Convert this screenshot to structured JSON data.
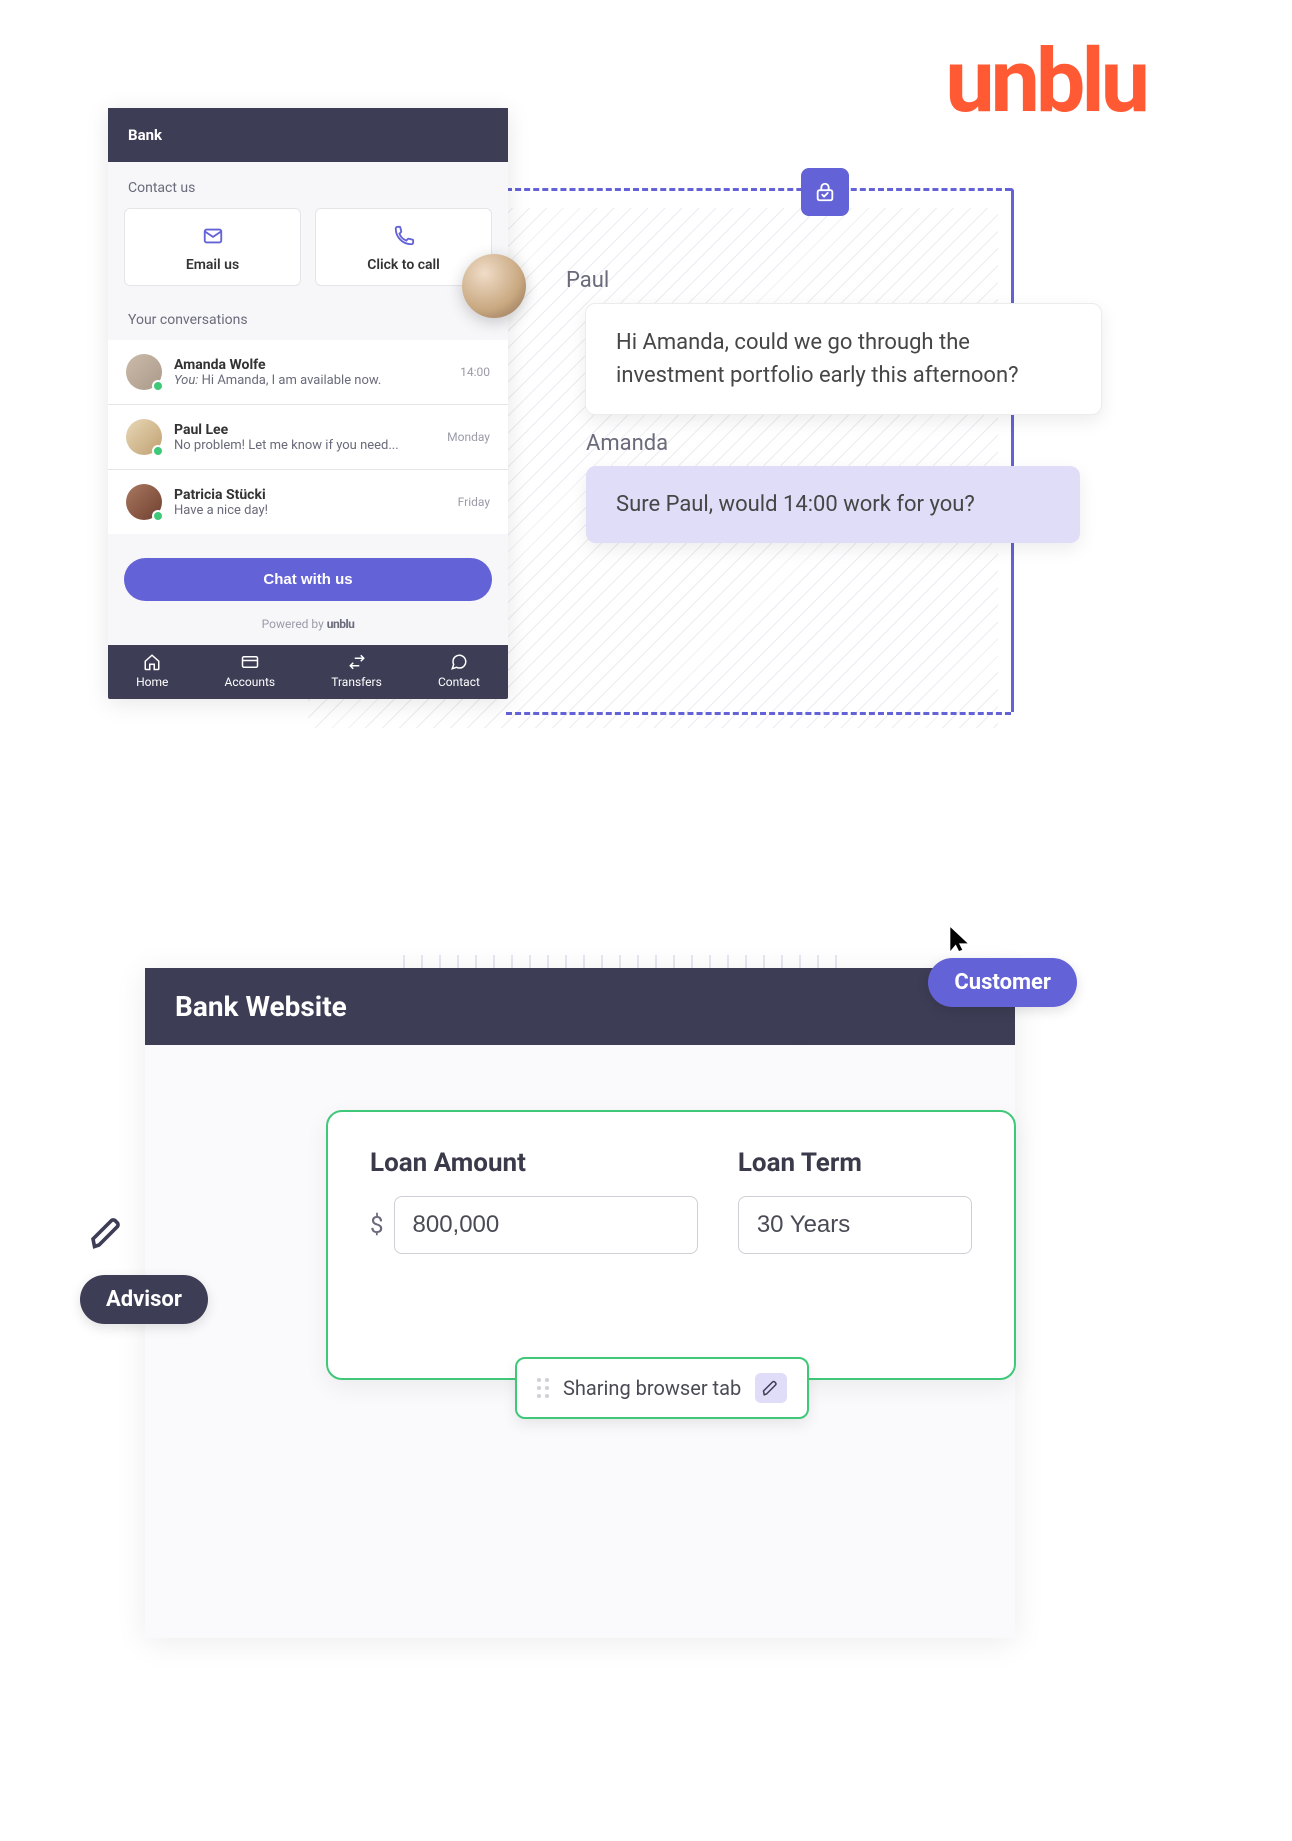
{
  "brand": {
    "logo_text": "unblu"
  },
  "panel_top": {
    "phone": {
      "header_title": "Bank",
      "contact_section_title": "Contact us",
      "email_label": "Email us",
      "call_label": "Click to call",
      "convo_section_title": "Your conversations",
      "conversations": [
        {
          "name": "Amanda Wolfe",
          "you_prefix": "You:",
          "preview": "Hi Amanda, I am available now.",
          "time": "14:00"
        },
        {
          "name": "Paul Lee",
          "you_prefix": "",
          "preview": "No problem! Let me know if you need...",
          "time": "Monday"
        },
        {
          "name": "Patricia Stücki",
          "you_prefix": "",
          "preview": "Have a nice day!",
          "time": "Friday"
        }
      ],
      "chat_button": "Chat with us",
      "powered_text": "Powered by",
      "powered_brand": "unblu",
      "nav": [
        {
          "label": "Home"
        },
        {
          "label": "Accounts"
        },
        {
          "label": "Transfers"
        },
        {
          "label": "Contact"
        }
      ]
    },
    "chat": {
      "paul_name": "Paul",
      "paul_message": "Hi Amanda, could we go through the investment portfolio early this afternoon?",
      "amanda_name": "Amanda",
      "amanda_message": "Sure Paul, would 14:00 work for you?"
    }
  },
  "panel_bottom": {
    "website_title": "Bank Website",
    "loan": {
      "amount_label": "Loan Amount",
      "amount_prefix": "$",
      "amount_value": "800,000",
      "term_label": "Loan Term",
      "term_value": "30 Years"
    },
    "share_label": "Sharing browser tab",
    "advisor_label": "Advisor",
    "customer_label": "Customer"
  }
}
